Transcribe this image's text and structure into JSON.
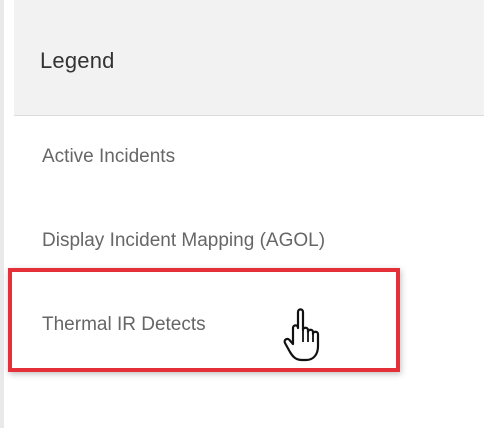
{
  "legend": {
    "title": "Legend",
    "items": [
      {
        "label": "Active Incidents"
      },
      {
        "label": "Display Incident Mapping (AGOL)"
      },
      {
        "label": "Thermal IR Detects"
      }
    ]
  },
  "annotation": {
    "highlight_color": "#e5303a",
    "cursor_icon": "hand-pointer-icon"
  }
}
